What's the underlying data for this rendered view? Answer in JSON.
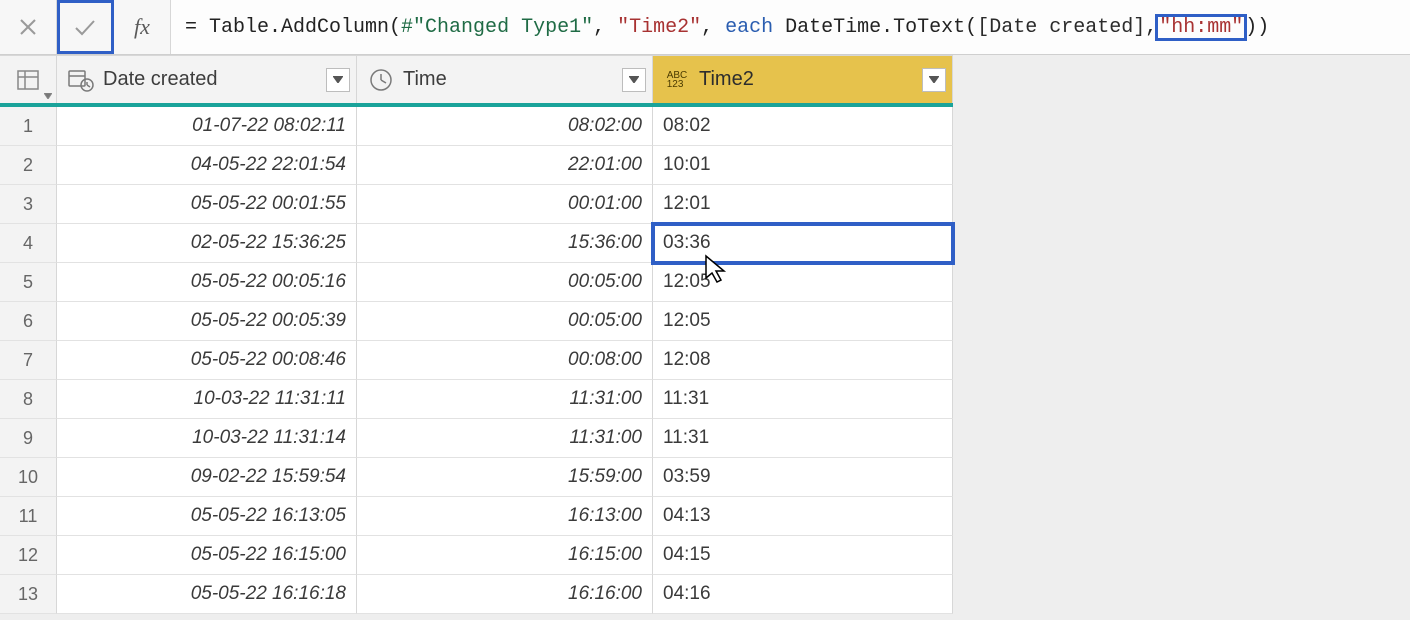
{
  "formula": {
    "prefix": "= Table.AddColumn(",
    "hash": "#\"Changed Type1\"",
    "sep1": ", ",
    "str_time2": "\"Time2\"",
    "sep2": ", ",
    "kw_each": "each",
    "mid": " DateTime.ToText(",
    "col_ref": "[Date created]",
    "sep3": ",",
    "str_hhmm": "\"hh:mm\"",
    "tail": "))"
  },
  "fx_label": "fx",
  "columns": {
    "date_created": "Date created",
    "time": "Time",
    "time2": "Time2",
    "any_icon_top": "ABC",
    "any_icon_bottom": "123"
  },
  "rows": [
    {
      "n": "1",
      "date": "01-07-22 08:02:11",
      "time": "08:02:00",
      "time2": "08:02"
    },
    {
      "n": "2",
      "date": "04-05-22 22:01:54",
      "time": "22:01:00",
      "time2": "10:01"
    },
    {
      "n": "3",
      "date": "05-05-22 00:01:55",
      "time": "00:01:00",
      "time2": "12:01"
    },
    {
      "n": "4",
      "date": "02-05-22 15:36:25",
      "time": "15:36:00",
      "time2": "03:36"
    },
    {
      "n": "5",
      "date": "05-05-22 00:05:16",
      "time": "00:05:00",
      "time2": "12:05"
    },
    {
      "n": "6",
      "date": "05-05-22 00:05:39",
      "time": "00:05:00",
      "time2": "12:05"
    },
    {
      "n": "7",
      "date": "05-05-22 00:08:46",
      "time": "00:08:00",
      "time2": "12:08"
    },
    {
      "n": "8",
      "date": "10-03-22 11:31:11",
      "time": "11:31:00",
      "time2": "11:31"
    },
    {
      "n": "9",
      "date": "10-03-22 11:31:14",
      "time": "11:31:00",
      "time2": "11:31"
    },
    {
      "n": "10",
      "date": "09-02-22 15:59:54",
      "time": "15:59:00",
      "time2": "03:59"
    },
    {
      "n": "11",
      "date": "05-05-22 16:13:05",
      "time": "16:13:00",
      "time2": "04:13"
    },
    {
      "n": "12",
      "date": "05-05-22 16:15:00",
      "time": "16:15:00",
      "time2": "04:15"
    },
    {
      "n": "13",
      "date": "05-05-22 16:16:18",
      "time": "16:16:00",
      "time2": "04:16"
    }
  ],
  "highlight_row_index": 3
}
